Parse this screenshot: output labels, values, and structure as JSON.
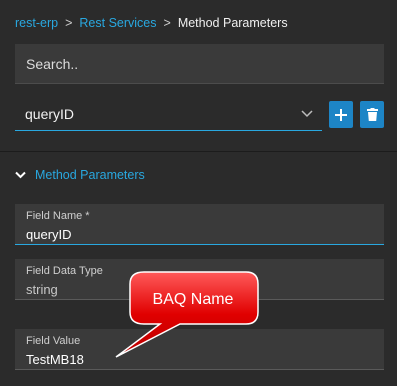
{
  "breadcrumb": {
    "items": [
      "rest-erp",
      "Rest Services"
    ],
    "separator": ">",
    "current": "Method Parameters"
  },
  "search": {
    "placeholder": "Search.."
  },
  "method_select": {
    "value": "queryID"
  },
  "buttons": {
    "add_icon": "plus-icon",
    "delete_icon": "trash-icon"
  },
  "section": {
    "title": "Method Parameters",
    "icon": "chevron-down-icon"
  },
  "fields": [
    {
      "label": "Field Name *",
      "value": "queryID"
    },
    {
      "label": "Field Data Type",
      "value": "string"
    },
    {
      "label": "Field Value",
      "value": "TestMB18"
    }
  ],
  "annotation": {
    "text": "BAQ Name",
    "color": "#e00000"
  },
  "colors": {
    "accent": "#29a8e0",
    "button": "#1d85c6",
    "background": "#2b2b2b"
  }
}
